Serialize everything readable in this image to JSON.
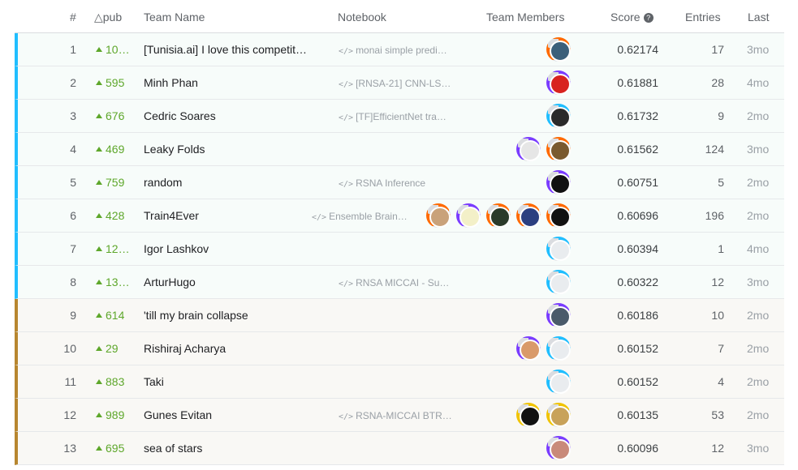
{
  "columns": {
    "rank": "#",
    "delta": "△pub",
    "team": "Team Name",
    "notebook": "Notebook",
    "members": "Team Members",
    "score": "Score",
    "entries": "Entries",
    "last": "Last"
  },
  "icons": {
    "score_help": "question-circle-icon",
    "notebook": "code-icon",
    "delta_up": "triangle-up-icon"
  },
  "colors": {
    "gold": "#20beff",
    "silver": "#b7862f",
    "delta_green": "#5ea72b",
    "avatar_ring_orange": "#ff6a00",
    "avatar_ring_purple": "#7a3cff",
    "avatar_ring_blue": "#20beff",
    "avatar_ring_gold": "#f0c300"
  },
  "rows": [
    {
      "rank": "1",
      "delta": "10…",
      "team": "[Tunisia.ai] I love this competit…",
      "notebook": "monai simple predi…",
      "score": "0.62174",
      "entries": "17",
      "last": "3mo",
      "tier": "gold",
      "avatars": [
        {
          "ring": "orange",
          "fill": "#3b5f7a"
        }
      ]
    },
    {
      "rank": "2",
      "delta": "595",
      "team": "Minh Phan",
      "notebook": "[RNSA-21] CNN-LS…",
      "score": "0.61881",
      "entries": "28",
      "last": "4mo",
      "tier": "gold",
      "avatars": [
        {
          "ring": "purple",
          "fill": "#d8231f"
        }
      ]
    },
    {
      "rank": "3",
      "delta": "676",
      "team": "Cedric Soares",
      "notebook": "[TF]EfficientNet tra…",
      "score": "0.61732",
      "entries": "9",
      "last": "2mo",
      "tier": "gold",
      "avatars": [
        {
          "ring": "blue",
          "fill": "#2a2a2a"
        }
      ]
    },
    {
      "rank": "4",
      "delta": "469",
      "team": "Leaky Folds",
      "notebook": "",
      "score": "0.61562",
      "entries": "124",
      "last": "3mo",
      "tier": "gold",
      "avatars": [
        {
          "ring": "purple",
          "fill": "#e6e6e6"
        },
        {
          "ring": "orange",
          "fill": "#7a5a2f"
        }
      ]
    },
    {
      "rank": "5",
      "delta": "759",
      "team": "random",
      "notebook": "RSNA Inference",
      "score": "0.60751",
      "entries": "5",
      "last": "2mo",
      "tier": "gold",
      "avatars": [
        {
          "ring": "purple",
          "fill": "#111111"
        }
      ]
    },
    {
      "rank": "6",
      "delta": "428",
      "team": "Train4Ever",
      "notebook": "Ensemble Brain…",
      "score": "0.60696",
      "entries": "196",
      "last": "2mo",
      "tier": "gold",
      "avatars": [
        {
          "ring": "orange",
          "fill": "#c9a27a"
        },
        {
          "ring": "purple",
          "fill": "#f3f0c8"
        },
        {
          "ring": "orange",
          "fill": "#2a3a2a"
        },
        {
          "ring": "orange",
          "fill": "#2b3f80"
        },
        {
          "ring": "orange",
          "fill": "#111111"
        }
      ]
    },
    {
      "rank": "7",
      "delta": "12…",
      "team": "Igor Lashkov",
      "notebook": "",
      "score": "0.60394",
      "entries": "1",
      "last": "4mo",
      "tier": "gold",
      "avatars": [
        {
          "ring": "blue",
          "fill": "#e9ecef"
        }
      ]
    },
    {
      "rank": "8",
      "delta": "13…",
      "team": "ArturHugo",
      "notebook": "RNSA MICCAI - Su…",
      "score": "0.60322",
      "entries": "12",
      "last": "3mo",
      "tier": "gold",
      "avatars": [
        {
          "ring": "blue",
          "fill": "#e9ecef"
        }
      ]
    },
    {
      "rank": "9",
      "delta": "614",
      "team": "'till my brain collapse",
      "notebook": "",
      "score": "0.60186",
      "entries": "10",
      "last": "2mo",
      "tier": "silver",
      "avatars": [
        {
          "ring": "purple",
          "fill": "#4a5a6a"
        }
      ]
    },
    {
      "rank": "10",
      "delta": "29",
      "team": "Rishiraj Acharya",
      "notebook": "",
      "score": "0.60152",
      "entries": "7",
      "last": "2mo",
      "tier": "silver",
      "avatars": [
        {
          "ring": "purple",
          "fill": "#d99a6a"
        },
        {
          "ring": "blue",
          "fill": "#e9ecef"
        }
      ]
    },
    {
      "rank": "11",
      "delta": "883",
      "team": "Taki",
      "notebook": "",
      "score": "0.60152",
      "entries": "4",
      "last": "2mo",
      "tier": "silver",
      "avatars": [
        {
          "ring": "blue",
          "fill": "#e9ecef"
        }
      ]
    },
    {
      "rank": "12",
      "delta": "989",
      "team": "Gunes Evitan",
      "notebook": "RSNA-MICCAI BTR…",
      "score": "0.60135",
      "entries": "53",
      "last": "2mo",
      "tier": "silver",
      "avatars": [
        {
          "ring": "gold",
          "fill": "#111111"
        },
        {
          "ring": "gold",
          "fill": "#c8a25a"
        }
      ]
    },
    {
      "rank": "13",
      "delta": "695",
      "team": "sea of stars",
      "notebook": "",
      "score": "0.60096",
      "entries": "12",
      "last": "3mo",
      "tier": "silver",
      "avatars": [
        {
          "ring": "purple",
          "fill": "#c98a7a"
        }
      ]
    }
  ]
}
